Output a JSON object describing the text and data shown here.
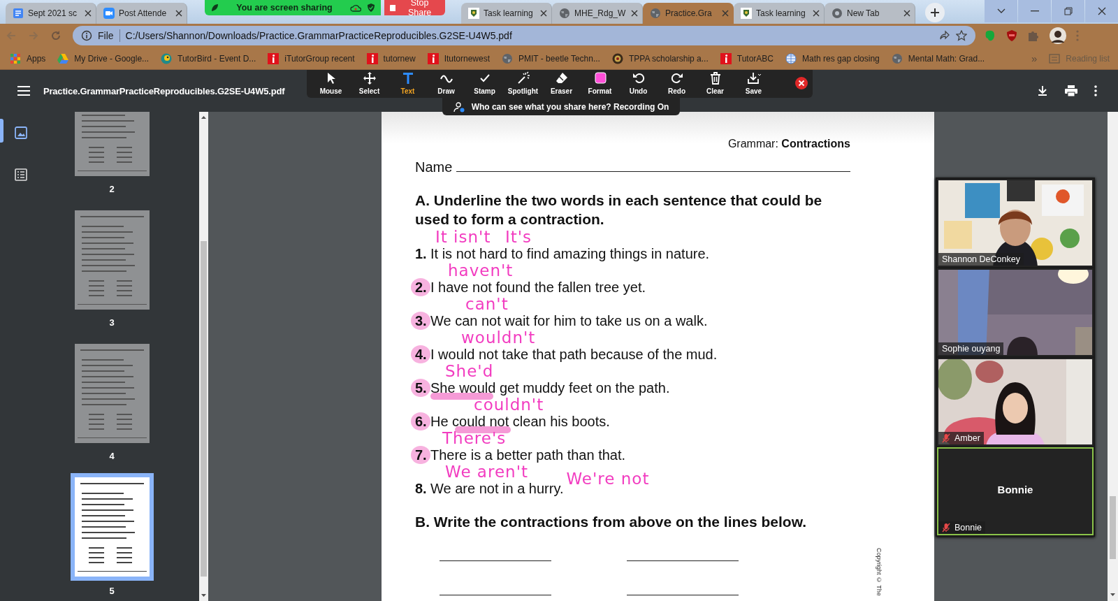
{
  "browser": {
    "tabs": [
      {
        "title": "Sept 2021 sc",
        "selected": false
      },
      {
        "title": "Post Attende",
        "selected": false
      },
      {
        "title": "Task learning",
        "selected": false
      },
      {
        "title": "MHE_Rdg_W",
        "selected": false
      },
      {
        "title": "Practice.Gra",
        "selected": true
      },
      {
        "title": "Task learning",
        "selected": false
      },
      {
        "title": "New Tab",
        "selected": false
      }
    ],
    "address": {
      "scheme": "File",
      "url": "C:/Users/Shannon/Downloads/Practice.GrammarPracticeReproducibles.G2SE-U4W5.pdf"
    },
    "bookmarks": [
      "Apps",
      "My Drive - Google...",
      "TutorBird - Event D...",
      "iTutorGroup recent",
      "tutornew",
      "Itutornewest",
      "PMIT - beetle Techn...",
      "TPPA scholarship a...",
      "TutorABC",
      "Math res gap closing",
      "Mental Math: Grad..."
    ],
    "more_bookmarks": "»",
    "reading_list": "Reading list"
  },
  "share_banner": {
    "status": "You are screen sharing",
    "stop": "Stop Share"
  },
  "pdf_viewer": {
    "filename": "Practice.GrammarPracticeReproducibles.G2SE-U4W5.pdf",
    "thumbnails": [
      {
        "page": "2",
        "selected": false
      },
      {
        "page": "3",
        "selected": false
      },
      {
        "page": "4",
        "selected": false
      },
      {
        "page": "5",
        "selected": true
      }
    ],
    "page": {
      "header": "Grammar: **Contractions**",
      "name_label": "Name",
      "heading_a": "A. Underline the two words in each sentence that could be used to form a contraction.",
      "sentences": [
        {
          "number": "1.",
          "text": "It is not hard to find amazing things in nature.",
          "circled": false,
          "stroke": false,
          "notes": [
            "It isn't",
            "It's"
          ]
        },
        {
          "number": "2.",
          "text": "I have not found the fallen tree yet.",
          "circled": true,
          "stroke": false,
          "notes": [
            "haven't"
          ]
        },
        {
          "number": "3.",
          "text": "We can not wait for him to take us on a walk.",
          "circled": true,
          "stroke": false,
          "notes": [
            "can't"
          ]
        },
        {
          "number": "4.",
          "text": "I would not take that path because of the mud.",
          "circled": true,
          "stroke": false,
          "notes": [
            "wouldn't"
          ]
        },
        {
          "number": "5.",
          "text": "She would get muddy feet on the path.",
          "circled": true,
          "stroke": true,
          "notes": [
            "She'd"
          ]
        },
        {
          "number": "6.",
          "text": "He could not clean his boots.",
          "circled": true,
          "stroke": true,
          "notes": [
            "couldn't"
          ]
        },
        {
          "number": "7.",
          "text": "There is a better path than that.",
          "circled": true,
          "stroke": false,
          "notes": [
            "There's"
          ]
        },
        {
          "number": "8.",
          "text": "We are not in a hurry.",
          "circled": false,
          "stroke": false,
          "notes": [
            "We aren't"
          ],
          "side_note": "We're not"
        }
      ],
      "heading_b": "B. Write the contractions from above on the lines below.",
      "copyright": "Copyright © The"
    }
  },
  "zoom_toolbar": {
    "tools": [
      {
        "label": "Mouse",
        "selected": false
      },
      {
        "label": "Select",
        "selected": false
      },
      {
        "label": "Text",
        "selected": true
      },
      {
        "label": "Draw",
        "selected": false
      },
      {
        "label": "Stamp",
        "selected": false
      },
      {
        "label": "Spotlight",
        "selected": false
      },
      {
        "label": "Eraser",
        "selected": false
      },
      {
        "label": "Format",
        "selected": false
      },
      {
        "label": "Undo",
        "selected": false
      },
      {
        "label": "Redo",
        "selected": false
      },
      {
        "label": "Clear",
        "selected": false
      },
      {
        "label": "Save",
        "selected": false
      }
    ],
    "notice": "Who can see what you share here? Recording On"
  },
  "video_panel": {
    "participants": [
      {
        "name": "Shannon DeConkey",
        "kind": "camera",
        "muted": false,
        "active": false
      },
      {
        "name": "Sophie ouyang",
        "kind": "camera",
        "muted": false,
        "active": false
      },
      {
        "name": "Amber",
        "kind": "camera",
        "muted": true,
        "active": false
      },
      {
        "name": "Bonnie",
        "kind": "no_video",
        "center_name": "Bonnie",
        "muted": true,
        "active": true
      }
    ]
  }
}
